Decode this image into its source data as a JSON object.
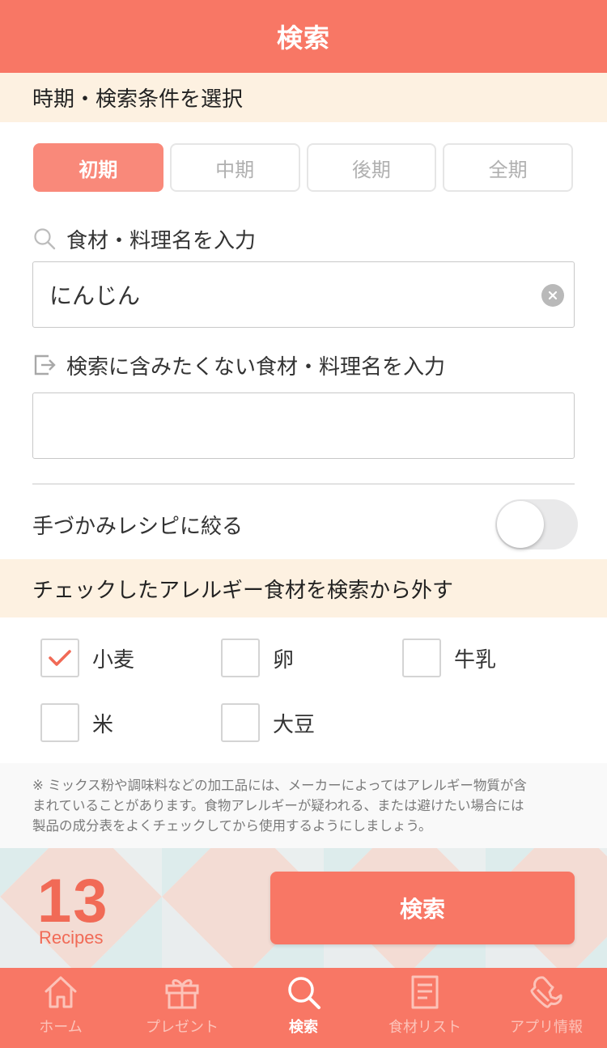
{
  "header": {
    "title": "検索"
  },
  "period_section": {
    "title": "時期・検索条件を選択",
    "tabs": [
      {
        "label": "初期",
        "active": true
      },
      {
        "label": "中期",
        "active": false
      },
      {
        "label": "後期",
        "active": false
      },
      {
        "label": "全期",
        "active": false
      }
    ]
  },
  "include_search": {
    "label": "食材・料理名を入力",
    "icon": "search-icon",
    "value": "にんじん"
  },
  "exclude_search": {
    "label": "検索に含みたくない食材・料理名を入力",
    "icon": "exclude-icon",
    "value": ""
  },
  "finger_food": {
    "label": "手づかみレシピに絞る",
    "enabled": false
  },
  "allergy_section": {
    "title": "チェックしたアレルギー食材を検索から外す",
    "items": [
      {
        "label": "小麦",
        "checked": true
      },
      {
        "label": "卵",
        "checked": false
      },
      {
        "label": "牛乳",
        "checked": false
      },
      {
        "label": "米",
        "checked": false
      },
      {
        "label": "大豆",
        "checked": false
      }
    ]
  },
  "notice": {
    "lines": [
      "※ ミックス粉や調味料などの加工品には、メーカーによってはアレルギー物質が含",
      "まれていることがあります。食物アレルギーが疑われる、または避けたい場合には",
      "製品の成分表をよくチェックしてから使用するようにしましょう。"
    ]
  },
  "result": {
    "count": "13",
    "unit": "Recipes",
    "search_button": "検索"
  },
  "tabbar": {
    "items": [
      {
        "label": "ホーム",
        "icon": "home-icon",
        "active": false
      },
      {
        "label": "プレゼント",
        "icon": "gift-icon",
        "active": false
      },
      {
        "label": "検索",
        "icon": "search-icon",
        "active": true
      },
      {
        "label": "食材リスト",
        "icon": "list-icon",
        "active": false
      },
      {
        "label": "アプリ情報",
        "icon": "wrench-icon",
        "active": false
      }
    ]
  },
  "colors": {
    "primary": "#f87765",
    "accent_light": "#f9897a",
    "band": "#fdf1e1",
    "count_text": "#f16a56"
  }
}
